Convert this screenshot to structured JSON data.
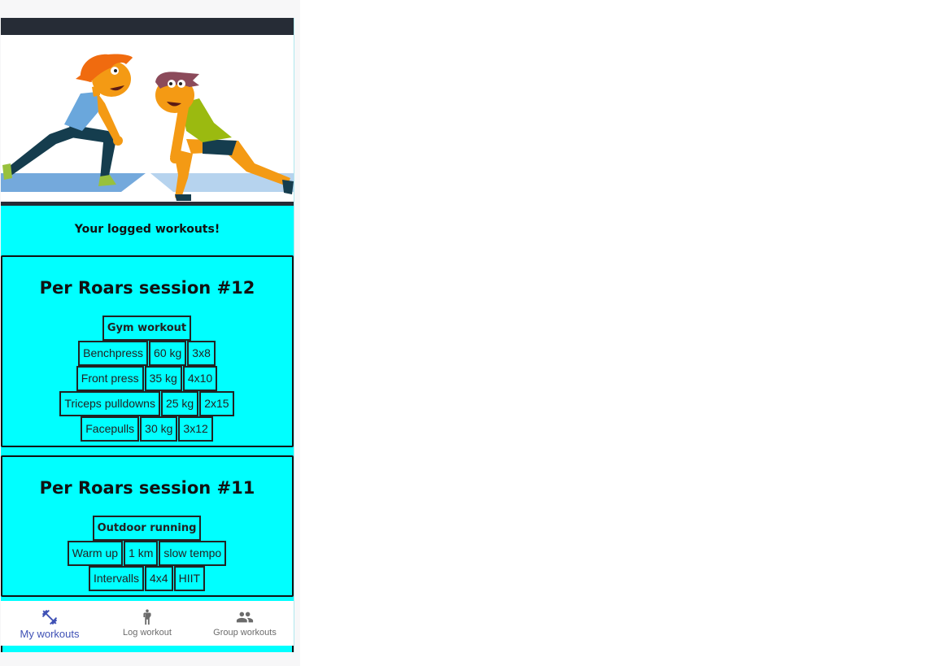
{
  "intro": {
    "text": "Your logged workouts!"
  },
  "sessions": [
    {
      "title": "Per Roars session #12",
      "workout_type": "Gym workout",
      "exercises": [
        {
          "name": "Benchpress",
          "load": "60 kg",
          "sets": "3x8"
        },
        {
          "name": "Front press",
          "load": "35 kg",
          "sets": "4x10"
        },
        {
          "name": "Triceps pulldowns",
          "load": "25 kg",
          "sets": "2x15"
        },
        {
          "name": "Facepulls",
          "load": "30 kg",
          "sets": "3x12"
        }
      ]
    },
    {
      "title": "Per Roars session #11",
      "workout_type": "Outdoor running",
      "exercises": [
        {
          "name": "Warm up",
          "load": "1 km",
          "sets": "slow tempo"
        },
        {
          "name": "Intervalls",
          "load": "4x4",
          "sets": "HIIT"
        }
      ]
    }
  ],
  "nav": {
    "items": [
      {
        "label": "My workouts",
        "icon": "dumbbell-icon",
        "active": true
      },
      {
        "label": "Log workout",
        "icon": "person-walking-icon",
        "active": false
      },
      {
        "label": "Group workouts",
        "icon": "group-icon",
        "active": false
      }
    ]
  },
  "colors": {
    "background": "#00ffff",
    "accent": "#3f51b5",
    "dark": "#262c36"
  }
}
